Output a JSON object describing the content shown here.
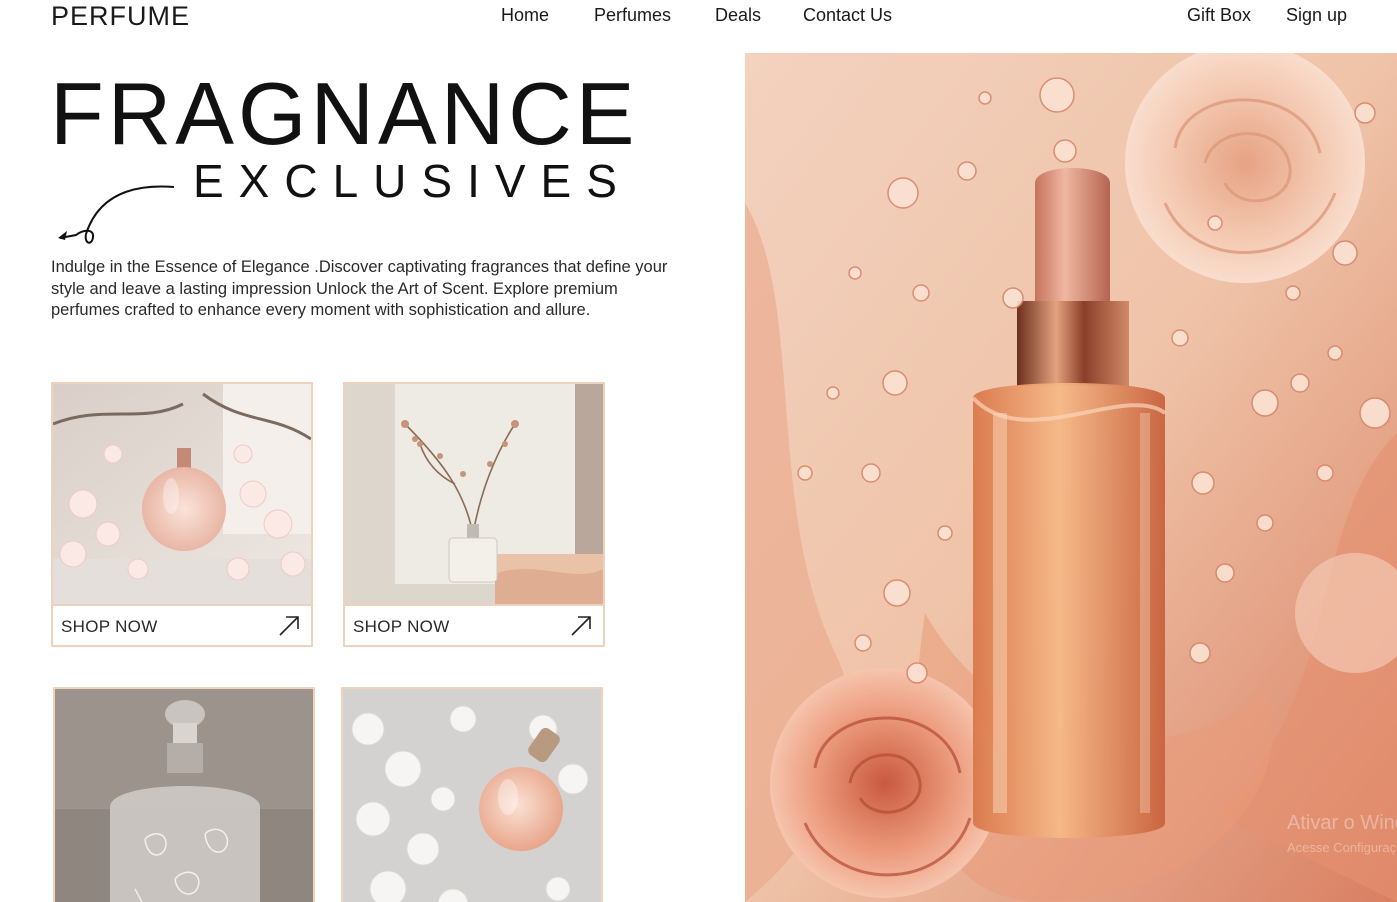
{
  "brand": {
    "logo": "PERFUME"
  },
  "nav": {
    "home": "Home",
    "perfumes": "Perfumes",
    "deals": "Deals",
    "contact": "Contact Us",
    "gift_box": "Gift Box",
    "sign_up": "Sign up"
  },
  "hero": {
    "title": "FRAGNANCE",
    "subtitle": "EXCLUSIVES",
    "description": "Indulge in the Essence of Elegance .Discover captivating fragrances that define your style and leave a lasting impression Unlock the Art of Scent. Explore premium perfumes crafted to enhance every moment with sophistication and allure."
  },
  "cards": [
    {
      "cta": "SHOP NOW",
      "arrow_icon": "arrow-up-right-icon"
    },
    {
      "cta": "SHOP NOW",
      "arrow_icon": "arrow-up-right-icon"
    }
  ],
  "watermark": {
    "line1": "Ativar o Windows",
    "line2": "Acesse Configurações"
  },
  "colors": {
    "accent_border": "#efd2bd",
    "peach": "#f3c4a8",
    "rose": "#e9967a",
    "text": "#1a1a1a"
  }
}
